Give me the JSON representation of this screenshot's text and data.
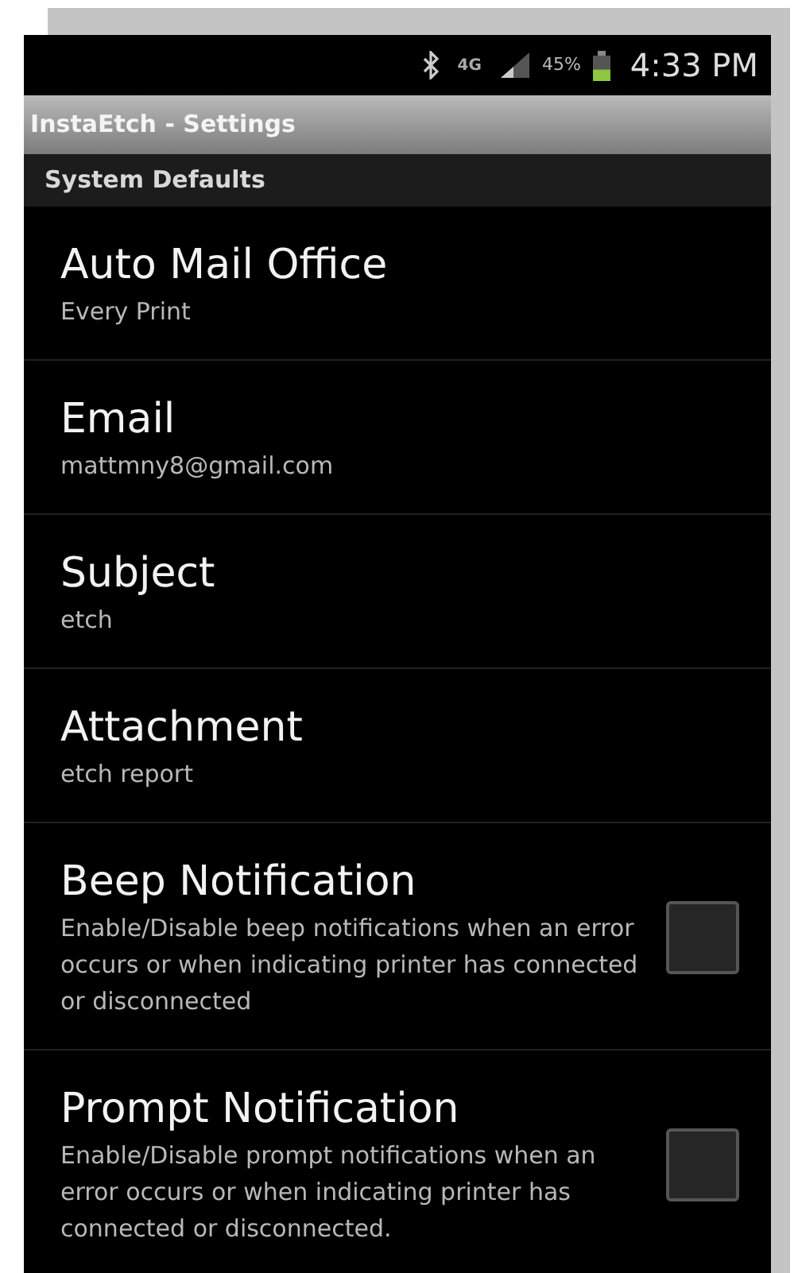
{
  "status_bar": {
    "network": "4G",
    "battery_percent": "45%",
    "battery": {
      "level": 0.45
    },
    "time": "4:33 PM"
  },
  "window": {
    "title": "InstaEtch - Settings"
  },
  "section": {
    "title": "System Defaults"
  },
  "settings": [
    {
      "kind": "text",
      "title": "Auto Mail Office",
      "summary": "Every Print"
    },
    {
      "kind": "text",
      "title": "Email",
      "summary": "mattmny8@gmail.com"
    },
    {
      "kind": "text",
      "title": "Subject",
      "summary": "etch"
    },
    {
      "kind": "text",
      "title": "Attachment",
      "summary": "etch report"
    },
    {
      "kind": "checkbox",
      "title": "Beep Notification",
      "summary": "Enable/Disable beep notifications when an error occurs or when indicating printer has connected or disconnected",
      "checked": false
    },
    {
      "kind": "checkbox",
      "title": "Prompt Notification",
      "summary": "Enable/Disable prompt notifications when an error occurs or when indicating printer has connected or disconnected.",
      "checked": false
    }
  ]
}
